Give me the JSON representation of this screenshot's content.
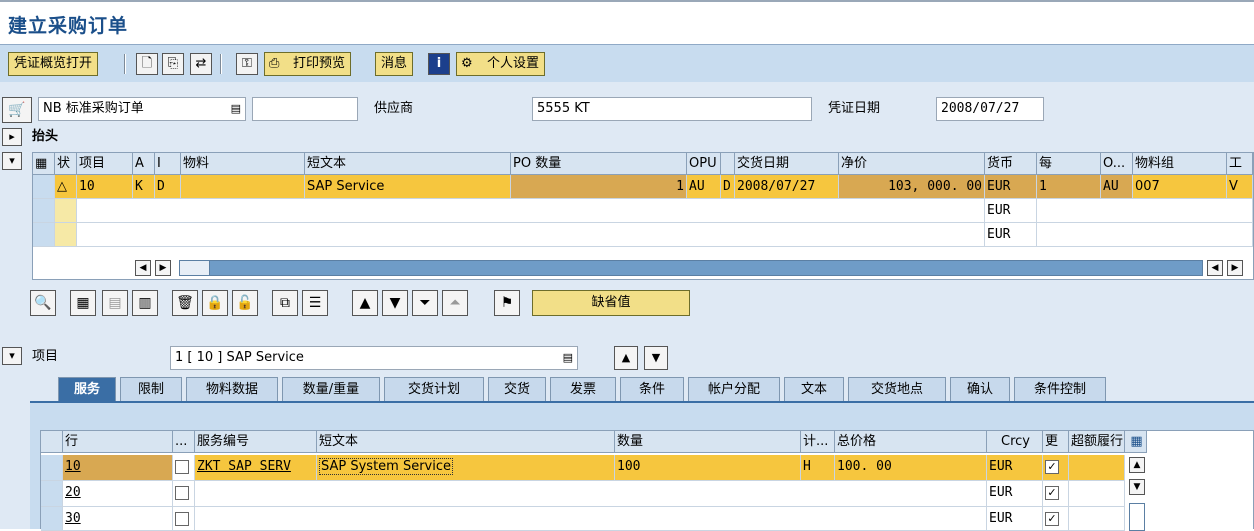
{
  "window": {
    "title": "建立采购订单"
  },
  "toolbar": {
    "overview_btn": "凭证概览打开",
    "print_preview_btn": "打印预览",
    "messages_btn": "消息",
    "personal_settings_btn": "个人设置"
  },
  "header": {
    "order_type": "NB 标准采购订单",
    "order_number": "",
    "vendor_label": "供应商",
    "vendor_value": "5555 KT",
    "doc_date_label": "凭证日期",
    "doc_date_value": "2008/07/27",
    "header_section_label": "抬头"
  },
  "item_grid": {
    "columns": [
      "状",
      "项目",
      "A",
      "I",
      "物料",
      "短文本",
      "PO 数量",
      "OPU",
      "交货日期",
      "净价",
      "货币",
      "每",
      "O...",
      "物料组",
      "工"
    ],
    "rows": [
      {
        "status": "△",
        "item": "10",
        "A": "K",
        "I": "D",
        "material": "",
        "short_text": "SAP Service",
        "qty": "1",
        "opu": "AU",
        "d": "D",
        "delivery_date": "2008/07/27",
        "net_price": "103, 000. 00",
        "currency": "EUR",
        "per": "1",
        "o": "AU",
        "mat_group": "007",
        "plant": "V"
      },
      {
        "status": "",
        "item": "",
        "A": "",
        "I": "",
        "material": "",
        "short_text": "",
        "qty": "",
        "opu": "",
        "d": "",
        "delivery_date": "",
        "net_price": "",
        "currency": "EUR",
        "per": "",
        "o": "",
        "mat_group": "",
        "plant": ""
      },
      {
        "status": "",
        "item": "",
        "A": "",
        "I": "",
        "material": "",
        "short_text": "",
        "qty": "",
        "opu": "",
        "d": "",
        "delivery_date": "",
        "net_price": "",
        "currency": "EUR",
        "per": "",
        "o": "",
        "mat_group": "",
        "plant": ""
      }
    ],
    "default_values_btn": "缺省值"
  },
  "item_detail": {
    "label": "项目",
    "selected": "1 [ 10 ] SAP Service",
    "tabs": [
      "服务",
      "限制",
      "物料数据",
      "数量/重量",
      "交货计划",
      "交货",
      "发票",
      "条件",
      "帐户分配",
      "文本",
      "交货地点",
      "确认",
      "条件控制"
    ],
    "active_tab": "服务"
  },
  "service_grid": {
    "columns": [
      "行",
      "...",
      "服务编号",
      "短文本",
      "数量",
      "计...",
      "总价格",
      "Crcy",
      "更",
      "超额履行"
    ],
    "rows": [
      {
        "line": "10",
        "service_no": "ZKT SAP SERV",
        "short_text": "SAP System Service",
        "qty": "100",
        "unit": "H",
        "gross_price": "100. 00",
        "currency": "EUR",
        "checked": true
      },
      {
        "line": "20",
        "service_no": "",
        "short_text": "",
        "qty": "",
        "unit": "",
        "gross_price": "",
        "currency": "EUR",
        "checked": true
      },
      {
        "line": "30",
        "service_no": "",
        "short_text": "",
        "qty": "",
        "unit": "",
        "gross_price": "",
        "currency": "EUR",
        "checked": true
      }
    ]
  },
  "icons": {
    "check": "✓"
  }
}
